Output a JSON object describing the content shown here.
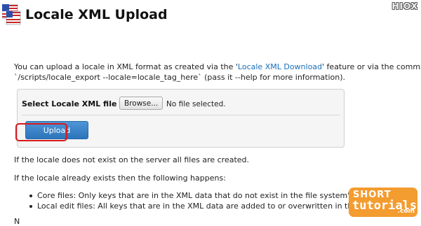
{
  "header": {
    "title": "Locale XML Upload",
    "icon": "locale-flag-icon",
    "watermark": "HIOX"
  },
  "intro": {
    "line1_before": "You can upload a locale in XML format as created via the '",
    "link_text": "Locale XML Download",
    "line1_after": "' feature or via the command",
    "line2": "`/scripts/locale_export --locale=locale_tag_here` (pass it --help for more information)."
  },
  "upload_form": {
    "file_label": "Select Locale XML file",
    "browse_label": "Browse...",
    "file_status": "No file selected.",
    "upload_label": "Upload"
  },
  "notes": {
    "not_exist": "If the locale does not exist on the server all files are created.",
    "exists": "If the locale already exists then the following happens:",
    "bullets": [
      "Core files: Only keys that are in the XML data that do not exist in the file system's c",
      "Local edit files: All keys that are in the XML data are added to or overwritten in the"
    ],
    "partial": "N"
  },
  "badge": {
    "short": "SHORT",
    "tutorials": "tutorials",
    "tld": ".com"
  },
  "colors": {
    "link": "#1a6fb8",
    "upload_button": "#3a83c9",
    "highlight": "#d8181b",
    "badge": "#f39c30"
  }
}
